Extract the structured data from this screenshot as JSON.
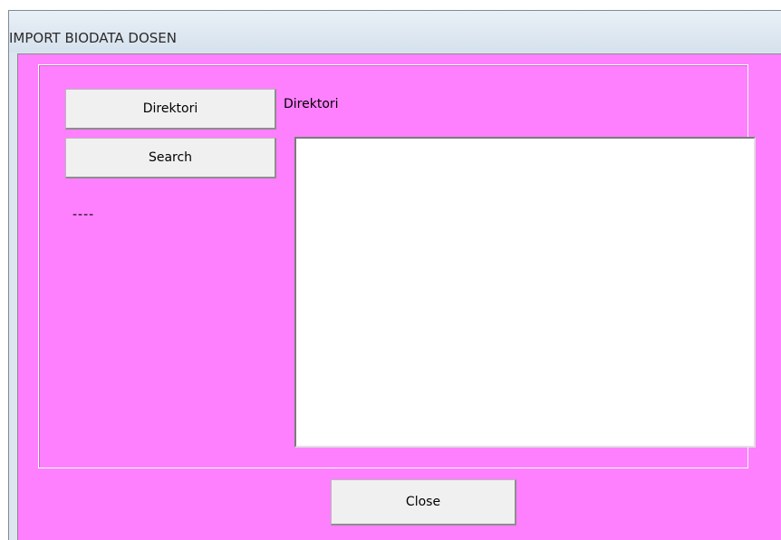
{
  "window": {
    "title": "IMPORT BIODATA DOSEN"
  },
  "form": {
    "directory_button_label": "Direktori",
    "search_button_label": "Search",
    "directory_path_label": "Direktori",
    "status_label": "----",
    "close_button_label": "Close"
  },
  "colors": {
    "form_background": "#ff80ff",
    "button_face": "#f0f0f0",
    "list_background": "#ffffff"
  }
}
